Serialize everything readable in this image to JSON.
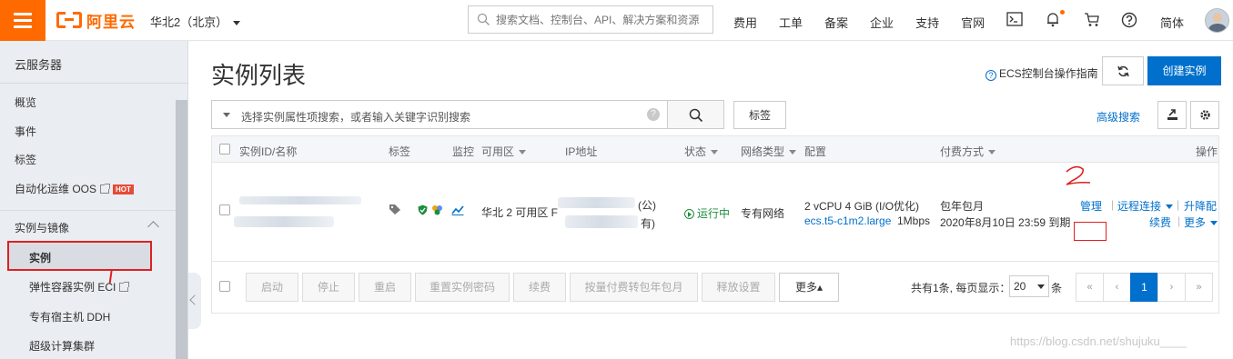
{
  "topbar": {
    "logo_text": "阿里云",
    "region": "华北2（北京）",
    "search_placeholder": "搜索文档、控制台、API、解决方案和资源",
    "nav": [
      "费用",
      "工单",
      "备案",
      "企业",
      "支持",
      "官网"
    ],
    "lang": "简体",
    "icons": [
      "terminal-icon",
      "bell-icon",
      "cart-icon",
      "help-icon"
    ],
    "accent": "#ff6a00"
  },
  "sidebar": {
    "title": "云服务器",
    "items": [
      {
        "label": "概览"
      },
      {
        "label": "事件"
      },
      {
        "label": "标签"
      },
      {
        "label": "自动化运维 OOS",
        "badge": "HOT"
      }
    ],
    "group": "实例与镜像",
    "sub_items": [
      {
        "label": "实例",
        "active": true
      },
      {
        "label": "弹性容器实例 ECI"
      },
      {
        "label": "专有宿主机 DDH"
      },
      {
        "label": "超级计算集群"
      }
    ]
  },
  "main": {
    "title": "实例列表",
    "guide_link": "ECS控制台操作指南",
    "create_button": "创建实例",
    "filter_placeholder": "选择实例属性项搜索，或者输入关键字识别搜索",
    "tag_button": "标签",
    "advanced_search": "高级搜索",
    "columns": [
      "实例ID/名称",
      "标签",
      "监控",
      "可用区",
      "IP地址",
      "状态",
      "网络类型",
      "配置",
      "付费方式",
      "操作"
    ],
    "row": {
      "zone": "华北 2 可用区 F",
      "ip_suffix_1": "(公)",
      "ip_suffix_2": "有)",
      "status": "运行中",
      "network": "专有网络",
      "config_line1": "2 vCPU 4 GiB (I/O优化)",
      "config_type": "ecs.t5-c1m2.large",
      "bandwidth": "1Mbps",
      "billing": "包年包月",
      "expire": "2020年8月10日 23:59 到期",
      "actions": {
        "manage": "管理",
        "remote": "远程连接",
        "upgrade": "升降配",
        "renew": "续费",
        "more": "更多"
      }
    },
    "footer_buttons": [
      "启动",
      "停止",
      "重启",
      "重置实例密码",
      "续费",
      "按量付费转包年包月",
      "释放设置"
    ],
    "footer_more": "更多▴",
    "pager": {
      "summary": "共有1条, 每页显示：",
      "page_size": "20",
      "unit": "条",
      "first": "«",
      "prev": "‹",
      "current": "1",
      "next": "›",
      "last": "»"
    }
  },
  "annotations": {
    "mark_number": "2"
  },
  "watermark": "https://blog.csdn.net/shujuku____"
}
